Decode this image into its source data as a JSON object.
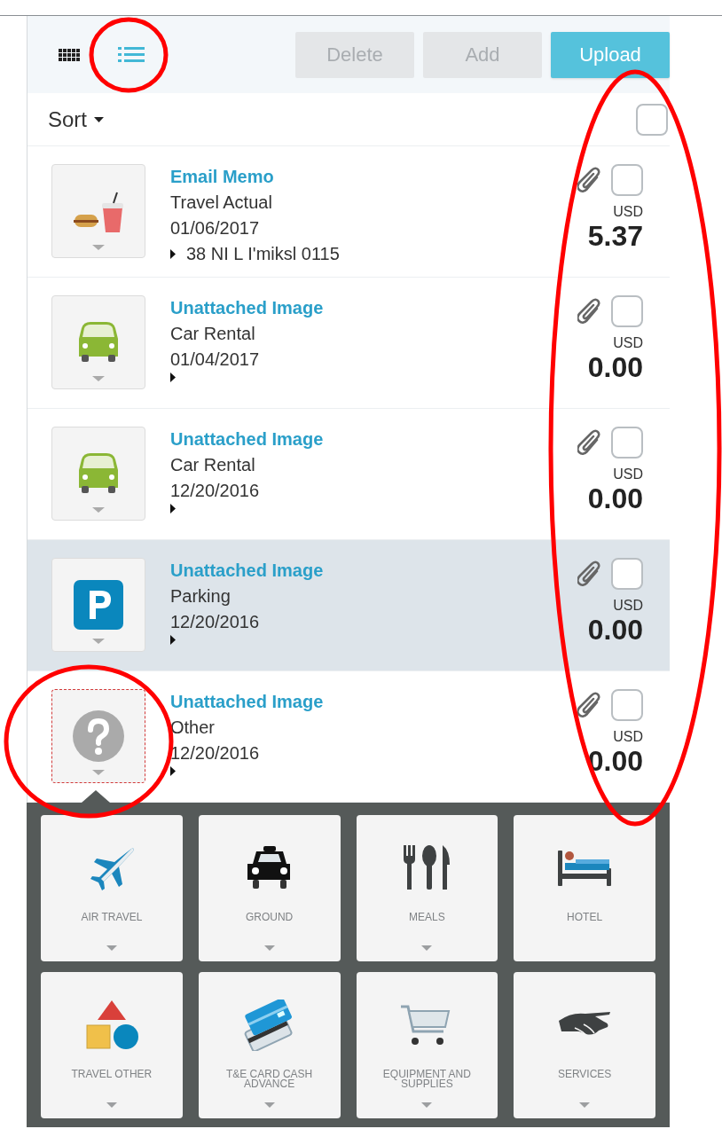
{
  "toolbar": {
    "views": [
      {
        "kind": "grid",
        "selected": false
      },
      {
        "kind": "list",
        "selected": true
      }
    ],
    "buttons": [
      {
        "label": "Delete",
        "disabled": true
      },
      {
        "label": "Add",
        "disabled": true
      },
      {
        "label": "Upload",
        "disabled": false
      }
    ]
  },
  "sort": {
    "label": "Sort",
    "select_all_checked": false
  },
  "expenses": [
    {
      "kind": "meals",
      "title": "Email Memo",
      "category": "Travel Actual",
      "date": "01/06/2017",
      "detail": "38 NI L I'miksl 0115",
      "currency": "USD",
      "amount": "5.37",
      "selected": false,
      "checked": false
    },
    {
      "kind": "car",
      "title": "Unattached Image",
      "category": "Car Rental",
      "date": "01/04/2017",
      "currency": "USD",
      "amount": "0.00",
      "selected": false,
      "checked": false
    },
    {
      "kind": "car",
      "title": "Unattached Image",
      "category": "Car Rental",
      "date": "12/20/2016",
      "currency": "USD",
      "amount": "0.00",
      "selected": false,
      "checked": false
    },
    {
      "kind": "parking",
      "title": "Unattached Image",
      "category": "Parking",
      "date": "12/20/2016",
      "currency": "USD",
      "amount": "0.00",
      "selected": true,
      "checked": false
    },
    {
      "kind": "unknown",
      "title": "Unattached Image",
      "category": "Other",
      "date": "12/20/2016",
      "currency": "USD",
      "amount": "0.00",
      "selected": false,
      "checked": false
    }
  ],
  "category_picker": [
    {
      "kind": "plane",
      "label": "AIR TRAVEL",
      "has_menu": true
    },
    {
      "kind": "taxi",
      "label": "GROUND",
      "has_menu": true
    },
    {
      "kind": "cutlery",
      "label": "MEALS",
      "has_menu": true
    },
    {
      "kind": "bed",
      "label": "HOTEL",
      "has_menu": false
    },
    {
      "kind": "shapes",
      "label": "TRAVEL OTHER",
      "has_menu": true
    },
    {
      "kind": "cards",
      "label": "T&E CARD CASH ADVANCE",
      "has_menu": true
    },
    {
      "kind": "cart",
      "label": "EQUIPMENT AND SUPPLIES",
      "has_menu": true
    },
    {
      "kind": "handshake",
      "label": "SERVICES",
      "has_menu": true
    }
  ]
}
